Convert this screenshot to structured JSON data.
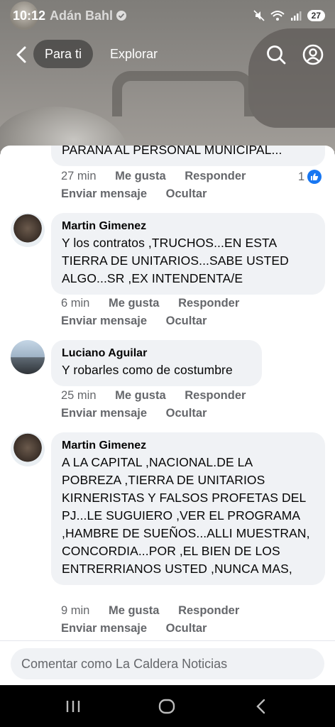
{
  "status_bar": {
    "time": "10:12",
    "page_name": "Adán Bahl",
    "battery": "27"
  },
  "nav": {
    "tab_for_you": "Para ti",
    "tab_explore": "Explorar"
  },
  "comments": [
    {
      "text": "PARANA AL PERSONAL MUNICIPAL...",
      "time": "27 min",
      "like": "Me gusta",
      "reply": "Responder",
      "send_message": "Enviar mensaje",
      "hide": "Ocultar",
      "reaction_count": "1"
    },
    {
      "author": "Martin Gimenez",
      "text": "Y los contratos ,TRUCHOS...EN ESTA TIERRA DE UNITARIOS...SABE USTED ALGO...SR ,EX INTENDENTA/E",
      "time": "6 min",
      "like": "Me gusta",
      "reply": "Responder",
      "send_message": "Enviar mensaje",
      "hide": "Ocultar"
    },
    {
      "author": "Luciano Aguilar",
      "text": "Y robarles como de costumbre",
      "time": "25 min",
      "like": "Me gusta",
      "reply": "Responder",
      "send_message": "Enviar mensaje",
      "hide": "Ocultar"
    },
    {
      "author": "Martin Gimenez",
      "text": "A LA CAPITAL ,NACIONAL.DE LA POBREZA ,TIERRA DE UNITARIOS KIRNERISTAS Y FALSOS PROFETAS DEL PJ...LE SUGUIERO ,VER EL PROGRAMA ,HAMBRE DE SUEÑOS...ALLI MUESTRAN, CONCORDIA...POR ,EL BIEN DE LOS ENTRERRIANOS USTED ,NUNCA MAS,",
      "time": "9 min",
      "like": "Me gusta",
      "reply": "Responder",
      "send_message": "Enviar mensaje",
      "hide": "Ocultar"
    }
  ],
  "composer": {
    "placeholder": "Comentar como La Caldera Noticias"
  },
  "colors": {
    "accent": "#1877f2",
    "bubble": "#f0f2f5",
    "meta_text": "#65676b"
  }
}
